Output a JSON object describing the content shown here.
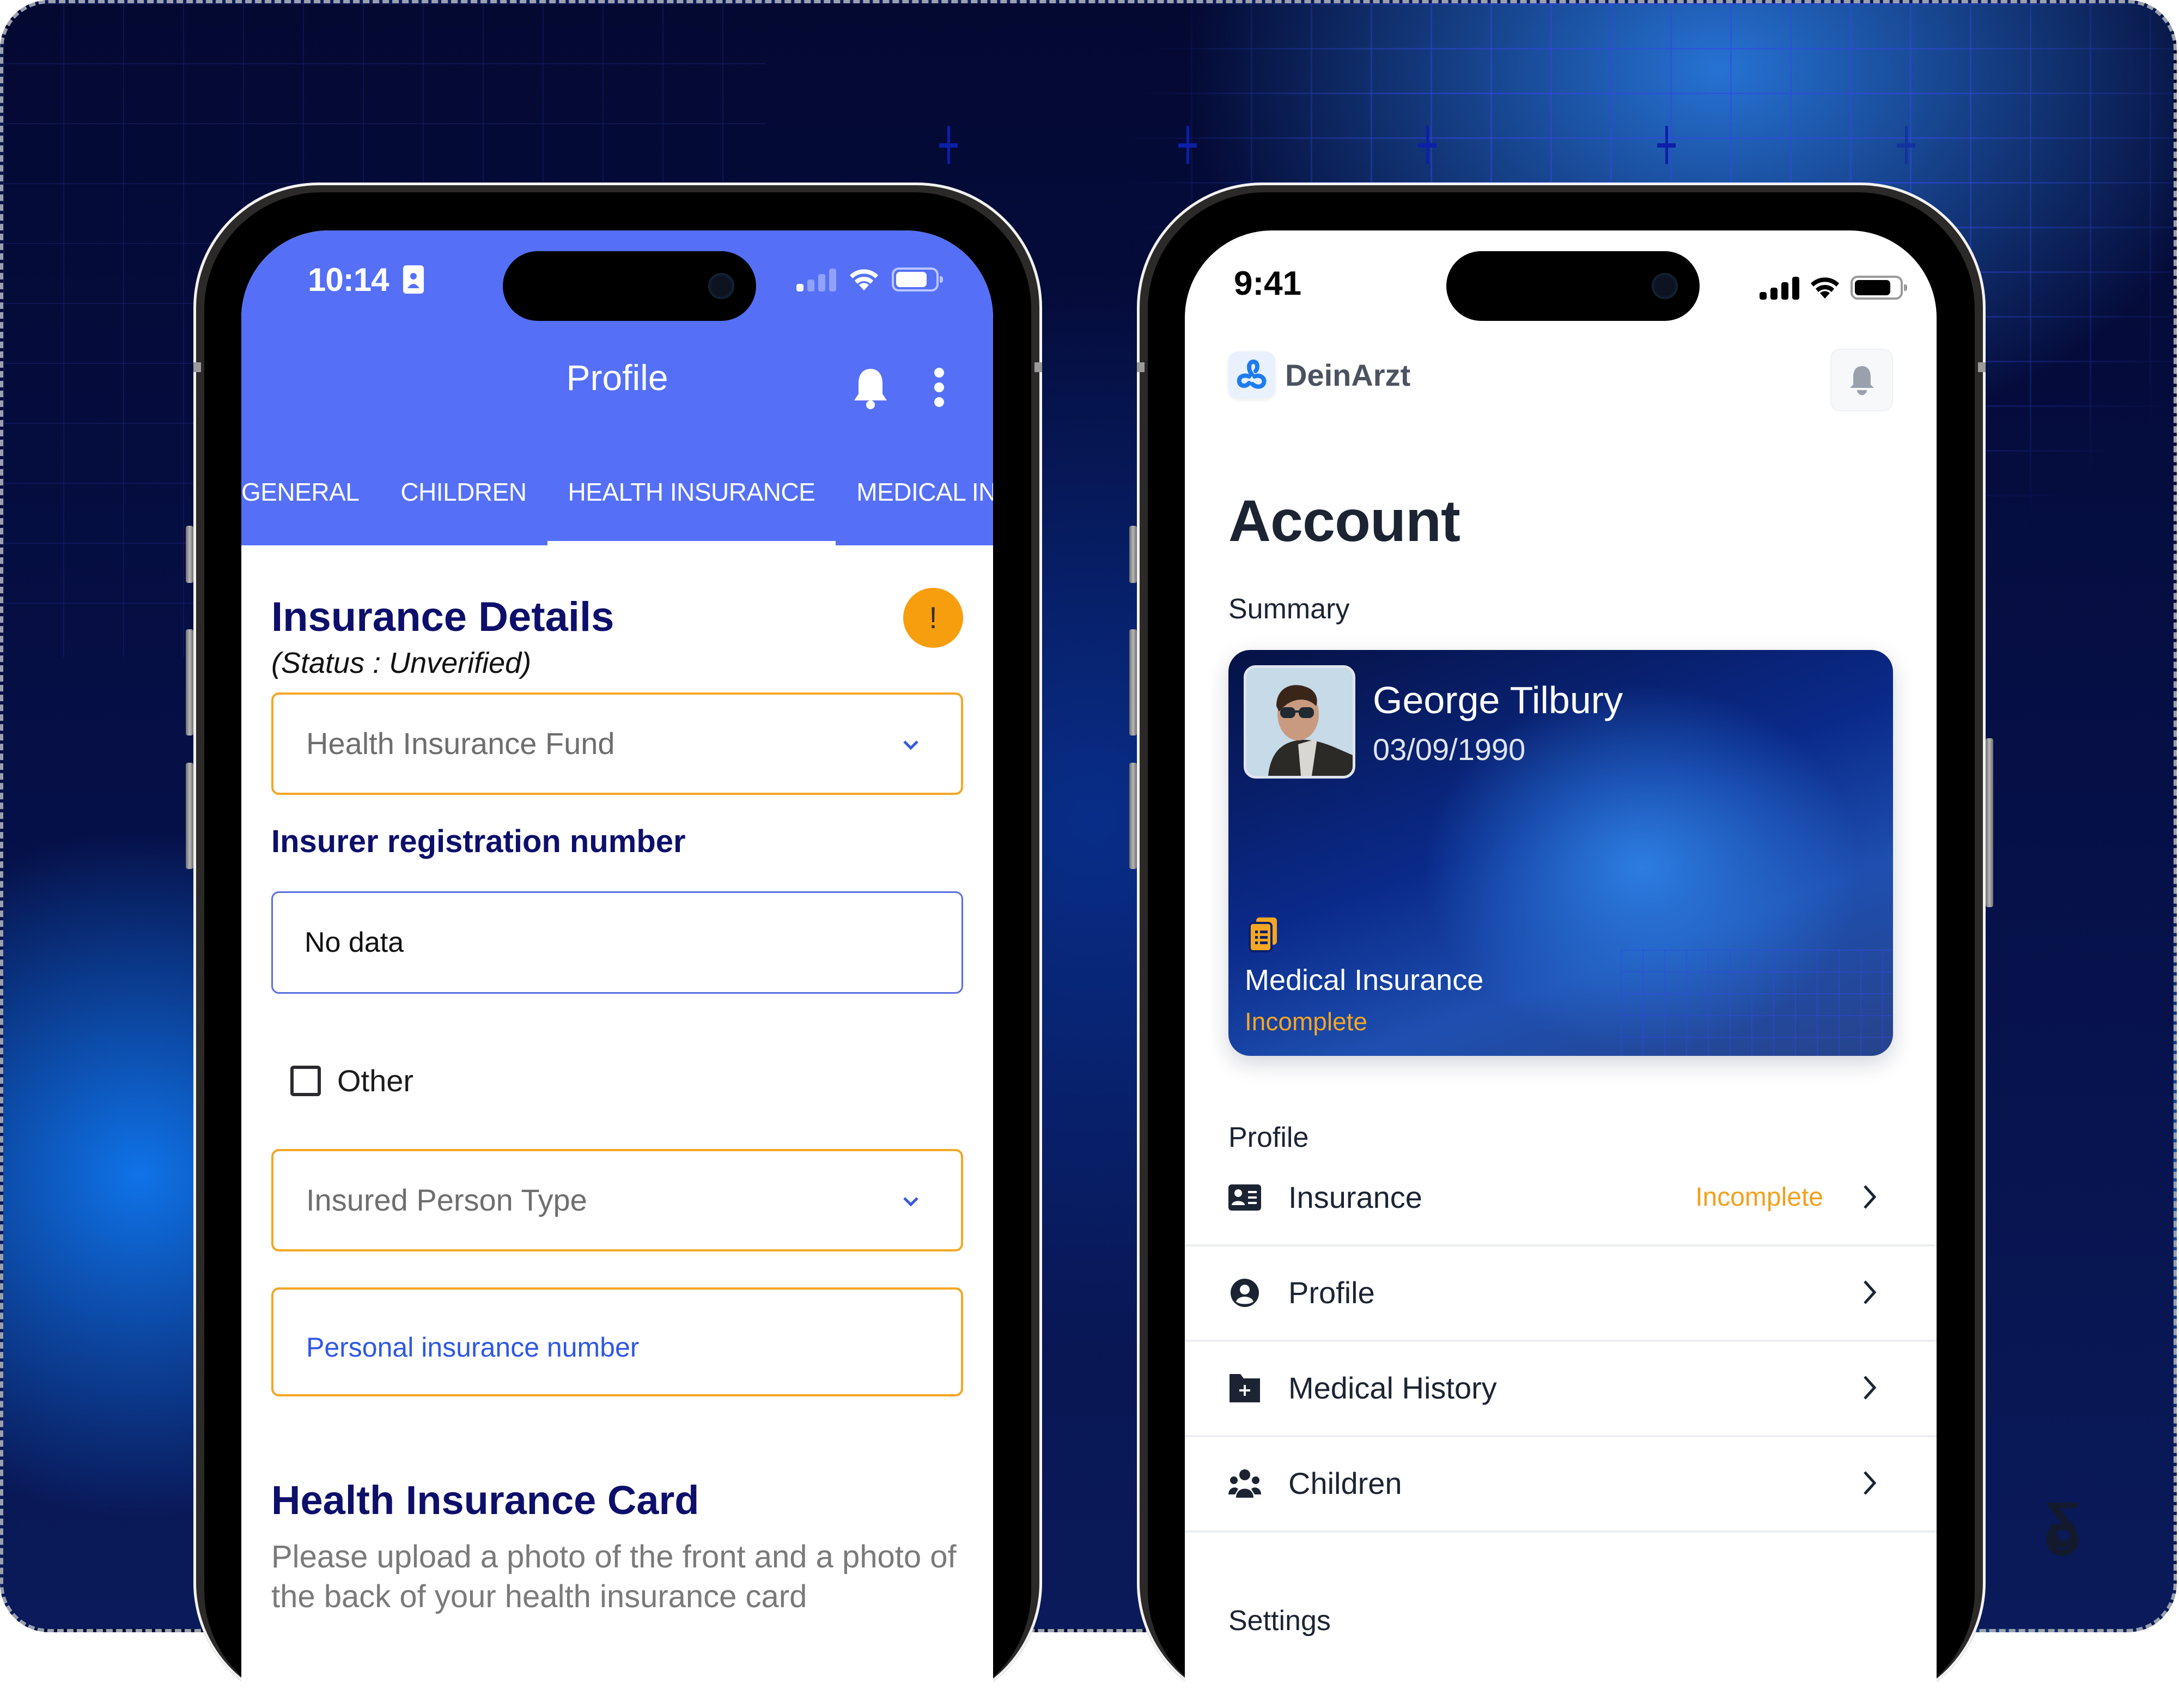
{
  "left_phone": {
    "status_bar": {
      "time": "10:14",
      "signal_bars_active": 1,
      "signal_bars_total": 4,
      "battery_level_percent": 90
    },
    "header": {
      "title": "Profile",
      "icons": [
        "bell-icon",
        "more-vertical-icon"
      ]
    },
    "tabs": [
      {
        "label": "GENERAL",
        "active": false
      },
      {
        "label": "CHILDREN",
        "active": false
      },
      {
        "label": "HEALTH INSURANCE",
        "active": true
      },
      {
        "label": "MEDICAL INFO",
        "active": false
      }
    ],
    "insurance_details": {
      "title": "Insurance Details",
      "status": "(Status : Unverified)",
      "warning_badge": "!",
      "fund_select_placeholder": "Health Insurance Fund",
      "registration_label": "Insurer registration number",
      "registration_value": "No data",
      "other_checkbox_label": "Other",
      "other_checked": false,
      "person_type_placeholder": "Insured Person Type",
      "personal_number_placeholder": "Personal insurance number"
    },
    "insurance_card": {
      "title": "Health Insurance Card",
      "description": "Please upload a photo of the front and a photo of the back of your health insurance card"
    }
  },
  "right_phone": {
    "status_bar": {
      "time": "9:41",
      "signal_bars_active": 4,
      "signal_bars_total": 4,
      "battery_level_percent": 90
    },
    "app": {
      "name": "DeinArzt",
      "logo_icon": "deinarzt-logo-icon",
      "notification_icon": "bell-icon"
    },
    "page_title": "Account",
    "summary": {
      "section_label": "Summary",
      "name": "George Tilbury",
      "dob": "03/09/1990",
      "insurance_label": "Medical Insurance",
      "insurance_status": "Incomplete"
    },
    "profile_section": {
      "label": "Profile",
      "items": [
        {
          "label": "Insurance",
          "icon": "id-card-icon",
          "badge": "Incomplete"
        },
        {
          "label": "Profile",
          "icon": "user-circle-icon",
          "badge": ""
        },
        {
          "label": "Medical History",
          "icon": "medical-folder-icon",
          "badge": ""
        },
        {
          "label": "Children",
          "icon": "users-icon",
          "badge": ""
        }
      ]
    },
    "settings_section": {
      "label": "Settings"
    }
  },
  "colors": {
    "left_header": "#5570f7",
    "warning": "#f5a623",
    "heading_navy": "#0d0f6b",
    "incomplete_orange": "#f1a11d",
    "brand_blue": "#1e7cf0"
  }
}
